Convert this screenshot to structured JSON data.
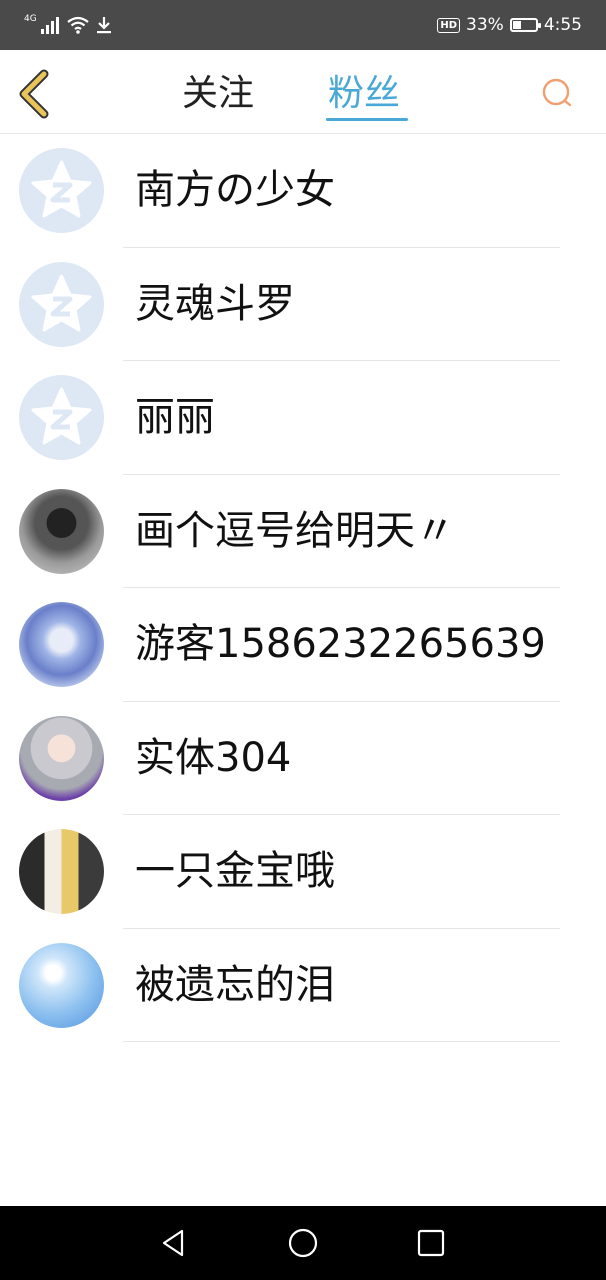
{
  "status_bar": {
    "network": "4G",
    "hd_label": "HD",
    "battery_percent": "33%",
    "battery_level": 0.33,
    "time": "4:55",
    "icons": [
      "signal-icon",
      "wifi-icon",
      "download-icon",
      "hd-icon",
      "battery-icon"
    ]
  },
  "header": {
    "tabs": [
      {
        "label": "关注",
        "selected": false
      },
      {
        "label": "粉丝",
        "selected": true
      }
    ],
    "back_icon": "back-chevron-icon",
    "search_icon": "search-icon",
    "accent_color": "#4aa8d8",
    "back_color": "#e8c45a",
    "search_color": "#f0a070"
  },
  "fans": [
    {
      "name": "南方の少女",
      "avatar": "qq-default-avatar"
    },
    {
      "name": "灵魂斗罗",
      "avatar": "qq-default-avatar"
    },
    {
      "name": "丽丽",
      "avatar": "qq-default-avatar"
    },
    {
      "name": "画个逗号给明天〃",
      "avatar": "photo-avatar"
    },
    {
      "name": "游客1586232265639",
      "avatar": "photo-avatar"
    },
    {
      "name": "实体304",
      "avatar": "photo-avatar"
    },
    {
      "name": "一只金宝哦",
      "avatar": "photo-avatar"
    },
    {
      "name": "被遗忘的泪",
      "avatar": "photo-avatar"
    }
  ],
  "nav_bar": {
    "buttons": [
      "back-triangle-icon",
      "home-circle-icon",
      "recents-square-icon"
    ]
  }
}
